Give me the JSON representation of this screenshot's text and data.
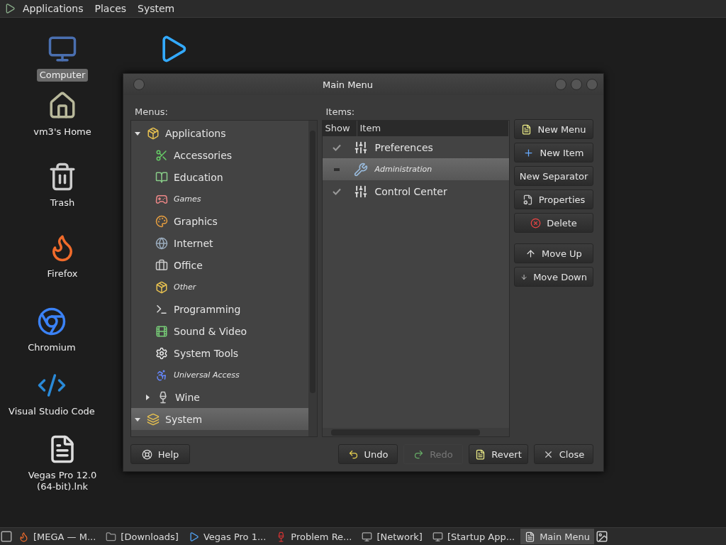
{
  "top_panel": {
    "menus": [
      "Applications",
      "Places",
      "System"
    ]
  },
  "desktop_icons": [
    {
      "label": "Computer",
      "selected": true
    },
    {
      "label": "vm3's Home",
      "selected": false
    },
    {
      "label": "Trash",
      "selected": false
    },
    {
      "label": "Firefox",
      "selected": false
    },
    {
      "label": "Chromium",
      "selected": false
    },
    {
      "label": "Visual Studio Code",
      "selected": false
    },
    {
      "label": "Vegas Pro 12.0 (64-bit).lnk",
      "selected": false
    }
  ],
  "window": {
    "title": "Main Menu",
    "menus_label": "Menus:",
    "items_label": "Items:",
    "menu_tree": [
      {
        "label": "Applications",
        "expanded": true,
        "hidden": false,
        "selected": false,
        "children": [
          {
            "label": "Accessories",
            "hidden": false,
            "selected": false
          },
          {
            "label": "Education",
            "hidden": false,
            "selected": false
          },
          {
            "label": "Games",
            "hidden": true,
            "selected": false
          },
          {
            "label": "Graphics",
            "hidden": false,
            "selected": false
          },
          {
            "label": "Internet",
            "hidden": false,
            "selected": false
          },
          {
            "label": "Office",
            "hidden": false,
            "selected": false
          },
          {
            "label": "Other",
            "hidden": true,
            "selected": false
          },
          {
            "label": "Programming",
            "hidden": false,
            "selected": false
          },
          {
            "label": "Sound & Video",
            "hidden": false,
            "selected": false
          },
          {
            "label": "System Tools",
            "hidden": false,
            "selected": false
          },
          {
            "label": "Universal Access",
            "hidden": true,
            "selected": false
          },
          {
            "label": "Wine",
            "hidden": false,
            "selected": false,
            "expanded": false
          }
        ]
      },
      {
        "label": "System",
        "expanded": true,
        "hidden": false,
        "selected": true
      }
    ],
    "items_columns": [
      "Show",
      "Item"
    ],
    "items": [
      {
        "label": "Preferences",
        "checked": true,
        "selected": false
      },
      {
        "label": "Administration",
        "checked": false,
        "selected": true
      },
      {
        "label": "Control Center",
        "checked": true,
        "selected": false
      }
    ],
    "side_buttons": [
      {
        "label": "New Menu",
        "disabled": false
      },
      {
        "label": "New Item",
        "disabled": false
      },
      {
        "label": "New Separator",
        "disabled": false
      },
      {
        "label": "Properties",
        "disabled": false
      },
      {
        "label": "Delete",
        "disabled": false
      },
      {
        "label": "Move Up",
        "disabled": false
      },
      {
        "label": "Move Down",
        "disabled": false
      }
    ],
    "help_button": {
      "label": "Help",
      "disabled": false
    },
    "bottom_buttons": [
      {
        "label": "Undo",
        "disabled": false
      },
      {
        "label": "Redo",
        "disabled": true
      },
      {
        "label": "Revert",
        "disabled": false
      },
      {
        "label": "Close",
        "disabled": false
      }
    ]
  },
  "taskbar": [
    {
      "label": "[MEGA — M...",
      "selected": false
    },
    {
      "label": "[Downloads]",
      "selected": false
    },
    {
      "label": "Vegas Pro 1...",
      "selected": false
    },
    {
      "label": "Problem Re...",
      "selected": false
    },
    {
      "label": "[Network]",
      "selected": false
    },
    {
      "label": "[Startup App...",
      "selected": false
    },
    {
      "label": "Main Menu",
      "selected": true
    }
  ]
}
